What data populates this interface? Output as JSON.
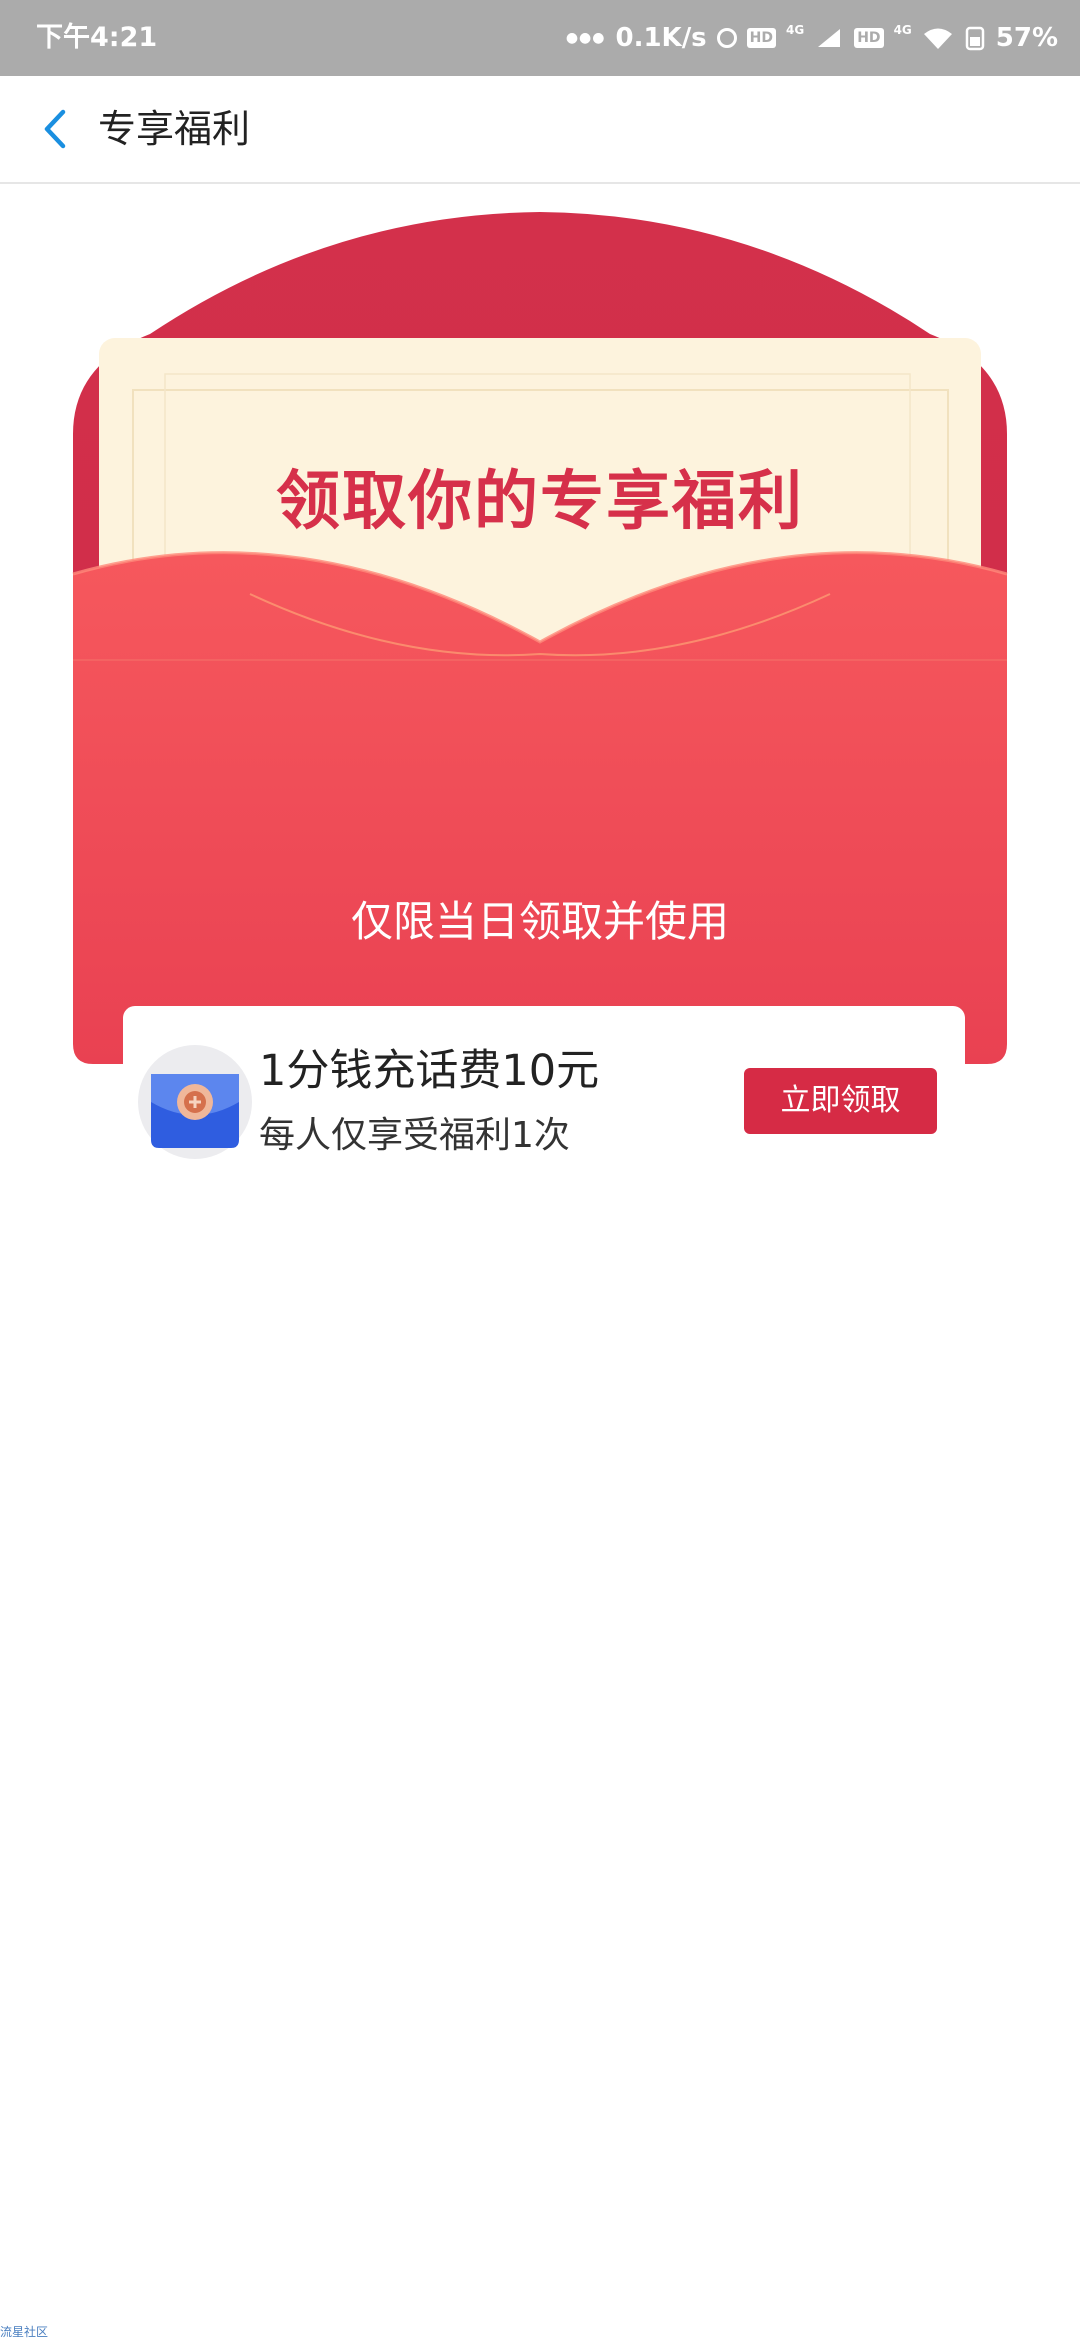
{
  "status_bar": {
    "time": "下午4:21",
    "network_speed": "0.1K/s",
    "sim1_badge": "HD",
    "sim1_type": "4G",
    "sim2_badge": "HD",
    "sim2_type": "4G",
    "battery": "57%",
    "icons": [
      "dots-icon",
      "alarm-clock-icon",
      "signal-icon",
      "wifi-icon",
      "battery-icon"
    ]
  },
  "header": {
    "back_icon": "chevron-left-icon",
    "title": "专享福利"
  },
  "envelope": {
    "letter_title": "领取你的专享福利",
    "notice": "仅限当日领取并使用",
    "offer": {
      "icon": "wallet-icon",
      "title": "1分钱充话费10元",
      "subtitle": "每人仅享受福利1次",
      "button_label": "立即领取"
    }
  },
  "watermark": "流星社区",
  "colors": {
    "status_bar": "#ababab",
    "back_arrow": "#1a8fe0",
    "envelope_back": "#d53650",
    "letter": "#fdf3dd",
    "envelope_front": "#f3525a",
    "accent_red": "#d62b45",
    "wallet_blue": "#2f5de0"
  }
}
